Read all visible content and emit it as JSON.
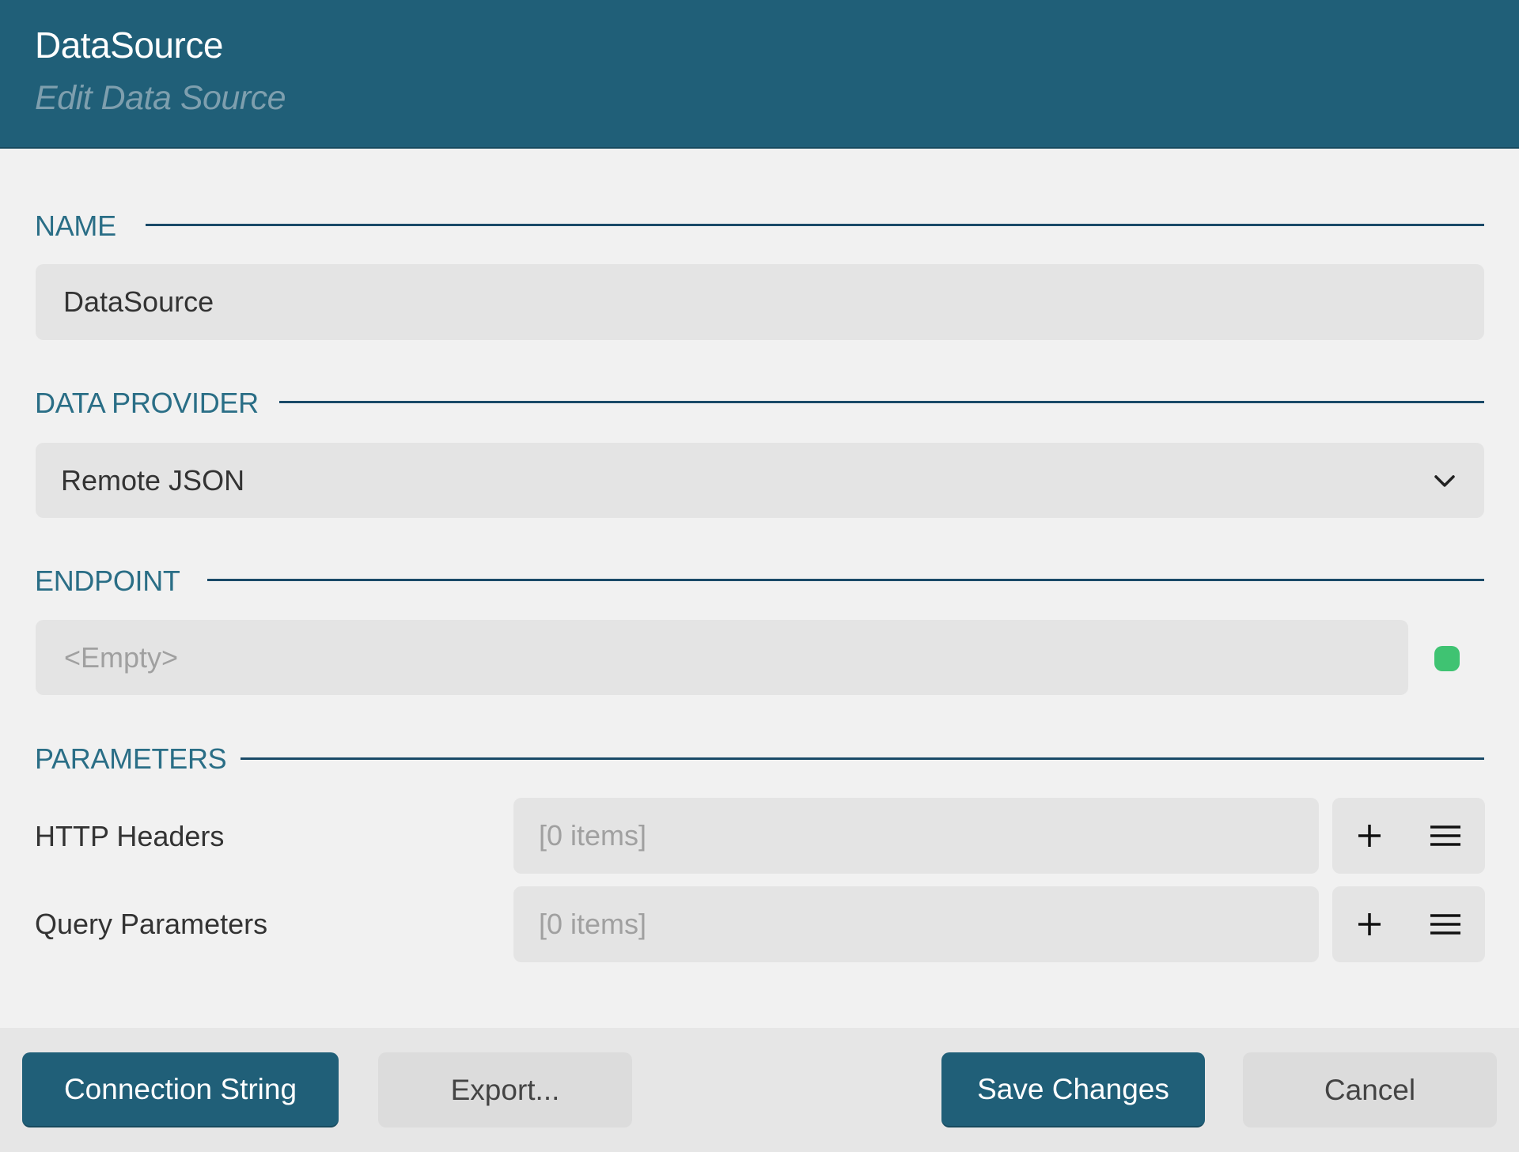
{
  "header": {
    "title": "DataSource",
    "subtitle": "Edit Data Source"
  },
  "sections": {
    "name": {
      "label": "NAME",
      "value": "DataSource"
    },
    "data_provider": {
      "label": "DATA PROVIDER",
      "selected": "Remote JSON",
      "icon": "chevron-down-icon"
    },
    "endpoint": {
      "label": "ENDPOINT",
      "placeholder": "<Empty>",
      "status": "ok",
      "status_color": "#3fc372"
    },
    "parameters": {
      "label": "PARAMETERS",
      "rows": [
        {
          "label": "HTTP Headers",
          "value": "[0 items]"
        },
        {
          "label": "Query Parameters",
          "value": "[0 items]"
        }
      ],
      "row_icons": [
        "plus-icon",
        "menu-icon"
      ]
    }
  },
  "footer": {
    "connection_string": "Connection String",
    "export": "Export...",
    "save": "Save Changes",
    "cancel": "Cancel"
  },
  "colors": {
    "primary": "#205f78",
    "section_label": "#2a6e86",
    "rule": "#1a4a68",
    "background": "#f1f1f1",
    "field": "#e4e4e4"
  }
}
